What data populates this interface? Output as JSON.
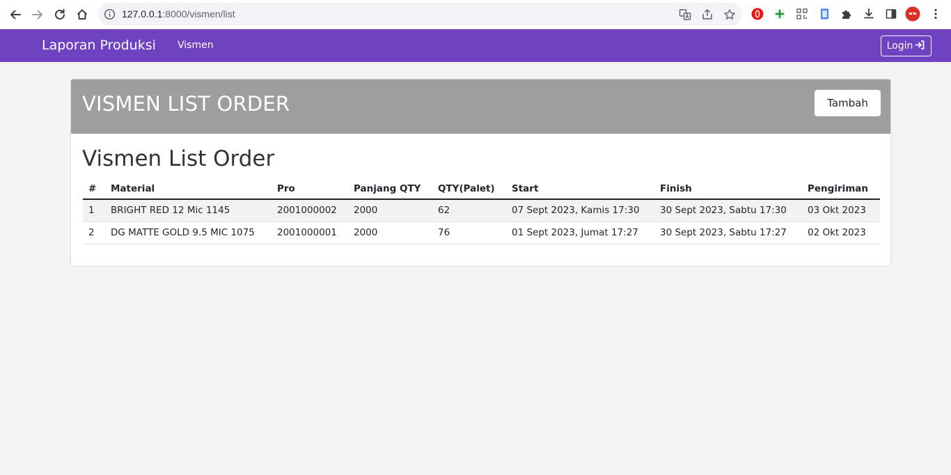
{
  "browser": {
    "url_host": "127.0.0.1",
    "url_path": ":8000/vismen/list"
  },
  "navbar": {
    "brand": "Laporan Produksi",
    "link_vismen": "Vismen",
    "login_label": "Login"
  },
  "header": {
    "title": "VISMEN LIST ORDER",
    "add_button": "Tambah"
  },
  "section": {
    "title": "Vismen List Order"
  },
  "table": {
    "columns": [
      "#",
      "Material",
      "Pro",
      "Panjang QTY",
      "QTY(Palet)",
      "Start",
      "Finish",
      "Pengiriman"
    ],
    "rows": [
      [
        "1",
        "BRIGHT RED 12 Mic 1145",
        "2001000002",
        "2000",
        "62",
        "07 Sept 2023, Kamis 17:30",
        "30 Sept 2023, Sabtu 17:30",
        "03 Okt 2023"
      ],
      [
        "2",
        "DG MATTE GOLD 9.5 MIC 1075",
        "2001000001",
        "2000",
        "76",
        "01 Sept 2023, Jumat 17:27",
        "30 Sept 2023, Sabtu 17:27",
        "02 Okt 2023"
      ]
    ]
  },
  "colors": {
    "navbar_bg": "#6f42c1",
    "header_bg": "#9e9e9e",
    "page_bg": "#f3f3f3"
  }
}
